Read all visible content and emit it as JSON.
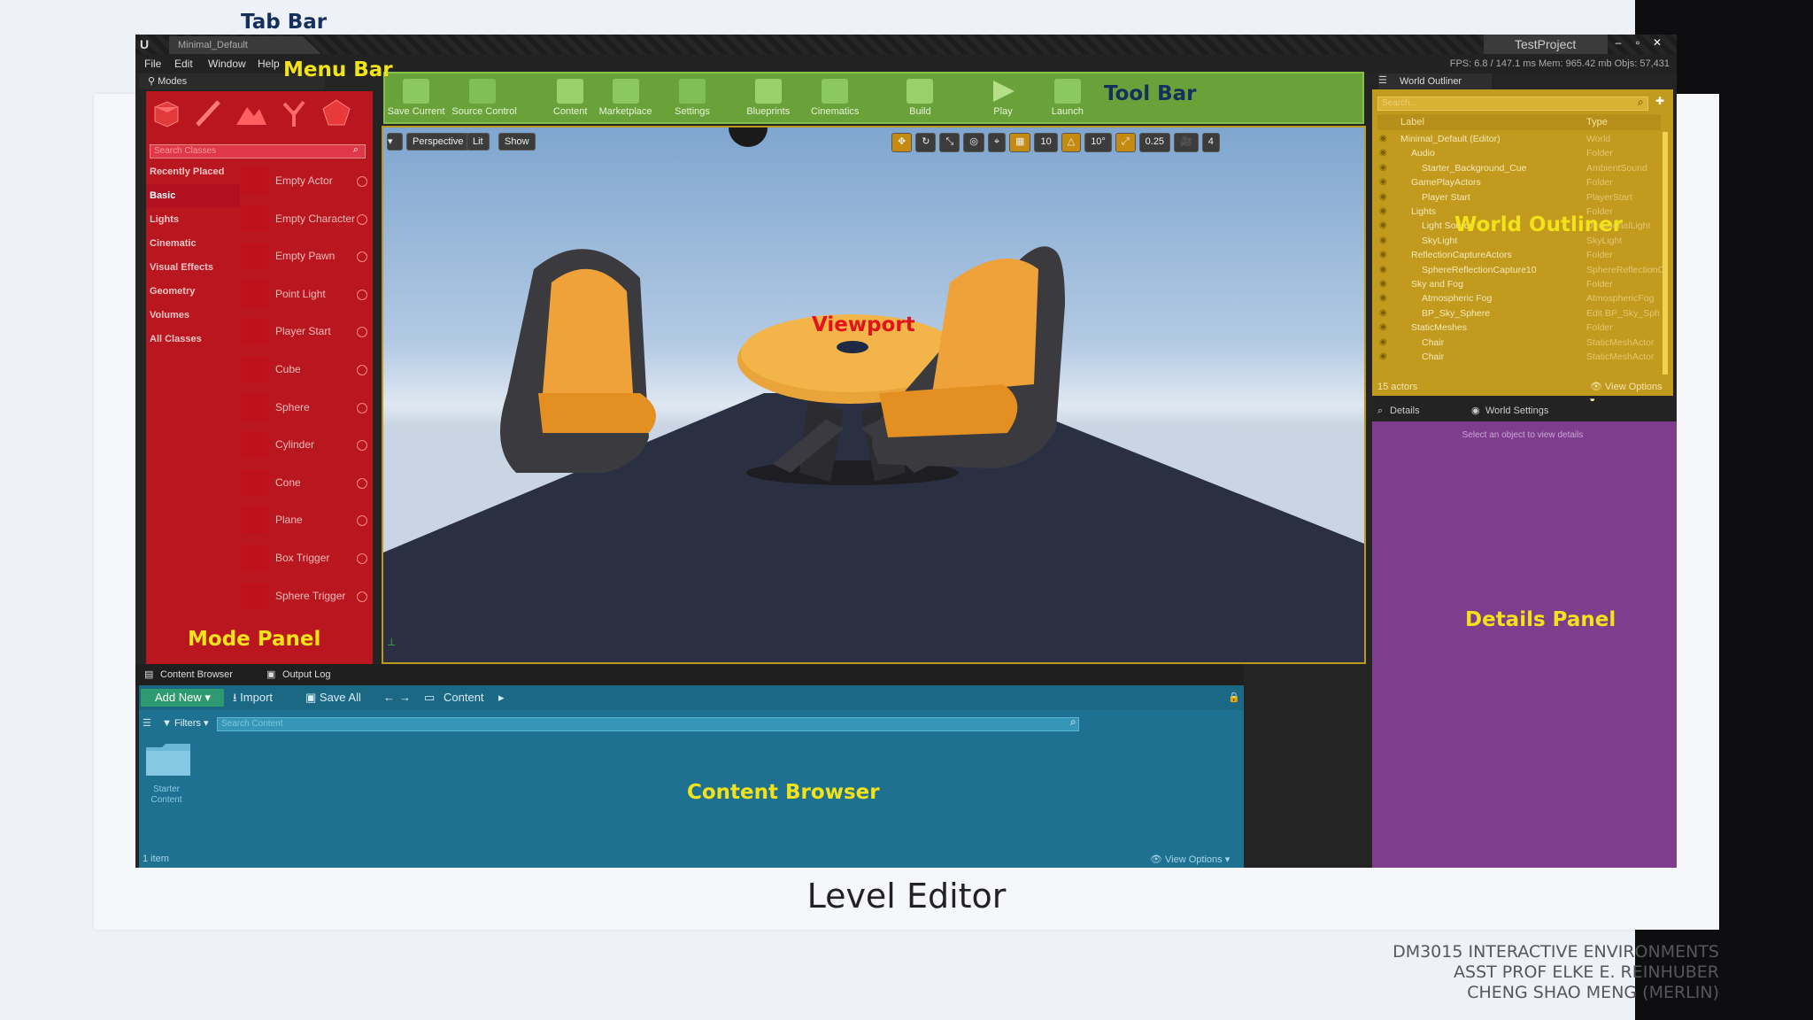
{
  "annotations": {
    "tab_bar": "Tab Bar",
    "menu_bar": "Menu Bar",
    "tool_bar": "Tool Bar",
    "world_outliner": "World Outliner",
    "viewport": "Viewport",
    "mode_panel": "Mode Panel",
    "details_panel": "Details Panel",
    "content_browser": "Content Browser"
  },
  "caption": "Level Editor",
  "credits": [
    "DM3015 INTERACTIVE ENVIRONMENTS",
    "ASST PROF ELKE E. REINHUBER",
    "CHENG SHAO MENG (MERLIN)"
  ],
  "window": {
    "tab_title": "Minimal_Default",
    "project_name": "TestProject",
    "stats": "FPS: 6.8  /  147.1 ms   Mem: 965.42 mb   Objs: 57,431",
    "menu": [
      "File",
      "Edit",
      "Window",
      "Help"
    ]
  },
  "modes": {
    "title": "Modes",
    "search_placeholder": "Search Classes",
    "categories": [
      "Recently Placed",
      "Basic",
      "Lights",
      "Cinematic",
      "Visual Effects",
      "Geometry",
      "Volumes",
      "All Classes"
    ],
    "items": [
      "Empty Actor",
      "Empty Character",
      "Empty Pawn",
      "Point Light",
      "Player Start",
      "Cube",
      "Sphere",
      "Cylinder",
      "Cone",
      "Plane",
      "Box Trigger",
      "Sphere Trigger"
    ]
  },
  "toolbar": {
    "buttons": [
      "Save Current",
      "Source Control",
      "Content",
      "Marketplace",
      "Settings",
      "Blueprints",
      "Cinematics",
      "Build",
      "Play",
      "Launch"
    ]
  },
  "viewport": {
    "view_mode": "Perspective",
    "lighting": "Lit",
    "show": "Show",
    "grid_snap": "10",
    "rotate_snap": "10°",
    "scale_snap": "0.25",
    "camera_speed": "4"
  },
  "outliner": {
    "title": "World Outliner",
    "search_placeholder": "Search...",
    "col_label": "Label",
    "col_type": "Type",
    "rows": [
      {
        "label": "Minimal_Default (Editor)",
        "type": "World"
      },
      {
        "label": "Audio",
        "type": "Folder"
      },
      {
        "label": "Starter_Background_Cue",
        "type": "AmbientSound"
      },
      {
        "label": "GamePlayActors",
        "type": "Folder"
      },
      {
        "label": "Player Start",
        "type": "PlayerStart"
      },
      {
        "label": "Lights",
        "type": "Folder"
      },
      {
        "label": "Light Source",
        "type": "DirectionalLight"
      },
      {
        "label": "SkyLight",
        "type": "SkyLight"
      },
      {
        "label": "ReflectionCaptureActors",
        "type": "Folder"
      },
      {
        "label": "SphereReflectionCapture10",
        "type": "SphereReflectionC"
      },
      {
        "label": "Sky and Fog",
        "type": "Folder"
      },
      {
        "label": "Atmospheric Fog",
        "type": "AtmosphericFog"
      },
      {
        "label": "BP_Sky_Sphere",
        "type": "Edit BP_Sky_Sph"
      },
      {
        "label": "StaticMeshes",
        "type": "Folder"
      },
      {
        "label": "Chair",
        "type": "StaticMeshActor"
      },
      {
        "label": "Chair",
        "type": "StaticMeshActor"
      }
    ],
    "actor_count": "15 actors",
    "view_options": "View Options"
  },
  "details": {
    "tab_details": "Details",
    "tab_world_settings": "World Settings",
    "empty_message": "Select an object to view details"
  },
  "content_browser": {
    "tab_content": "Content Browser",
    "tab_output": "Output Log",
    "add_new": "Add New",
    "import": "Import",
    "save_all": "Save All",
    "path": "Content",
    "filters": "Filters",
    "search_placeholder": "Search Content",
    "folder_name": "Starter Content",
    "item_count": "1 item",
    "view_options": "View Options"
  },
  "colors": {
    "mode_panel": "#d2141e",
    "tool_bar": "#6aa23a",
    "viewport_border": "#b89a1c",
    "world_outliner": "#c19a1e",
    "details_panel": "#7f3d8e",
    "content_browser": "#1f7191",
    "annotation_yellow": "#f2e21a",
    "annotation_red": "#e0141a",
    "annotation_navy": "#16305e"
  }
}
